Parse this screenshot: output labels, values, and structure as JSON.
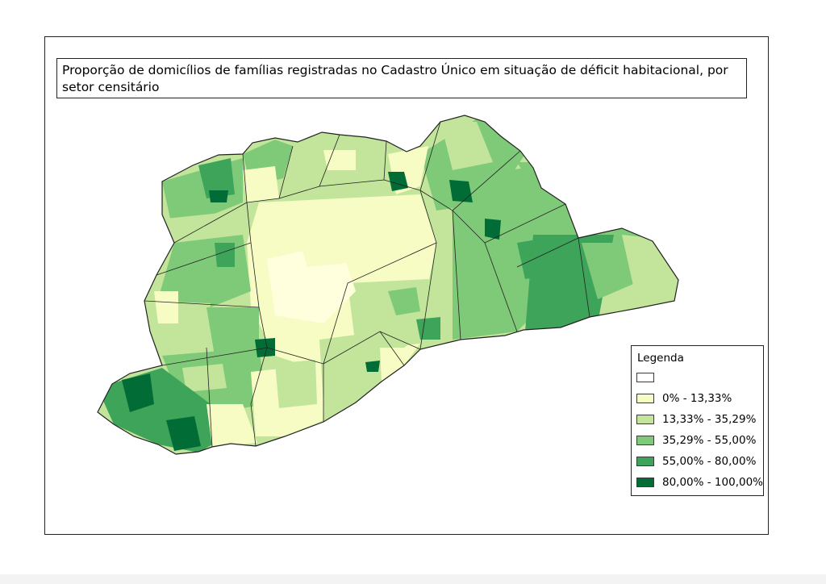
{
  "map": {
    "title": "Proporção de domicílios de famílias registradas no Cadastro Único em situação de déficit habitacional, por setor censitário"
  },
  "legend": {
    "title": "Legenda",
    "items": [
      {
        "label": "",
        "color": "#ffffff"
      },
      {
        "label": "0% - 13,33%",
        "color": "#f7fcc5"
      },
      {
        "label": "13,33% - 35,29%",
        "color": "#c2e59b"
      },
      {
        "label": "35,29% - 55,00%",
        "color": "#7fca78"
      },
      {
        "label": "55,00% - 80,00%",
        "color": "#3da45a"
      },
      {
        "label": "80,00% - 100,00%",
        "color": "#026c36"
      }
    ]
  }
}
